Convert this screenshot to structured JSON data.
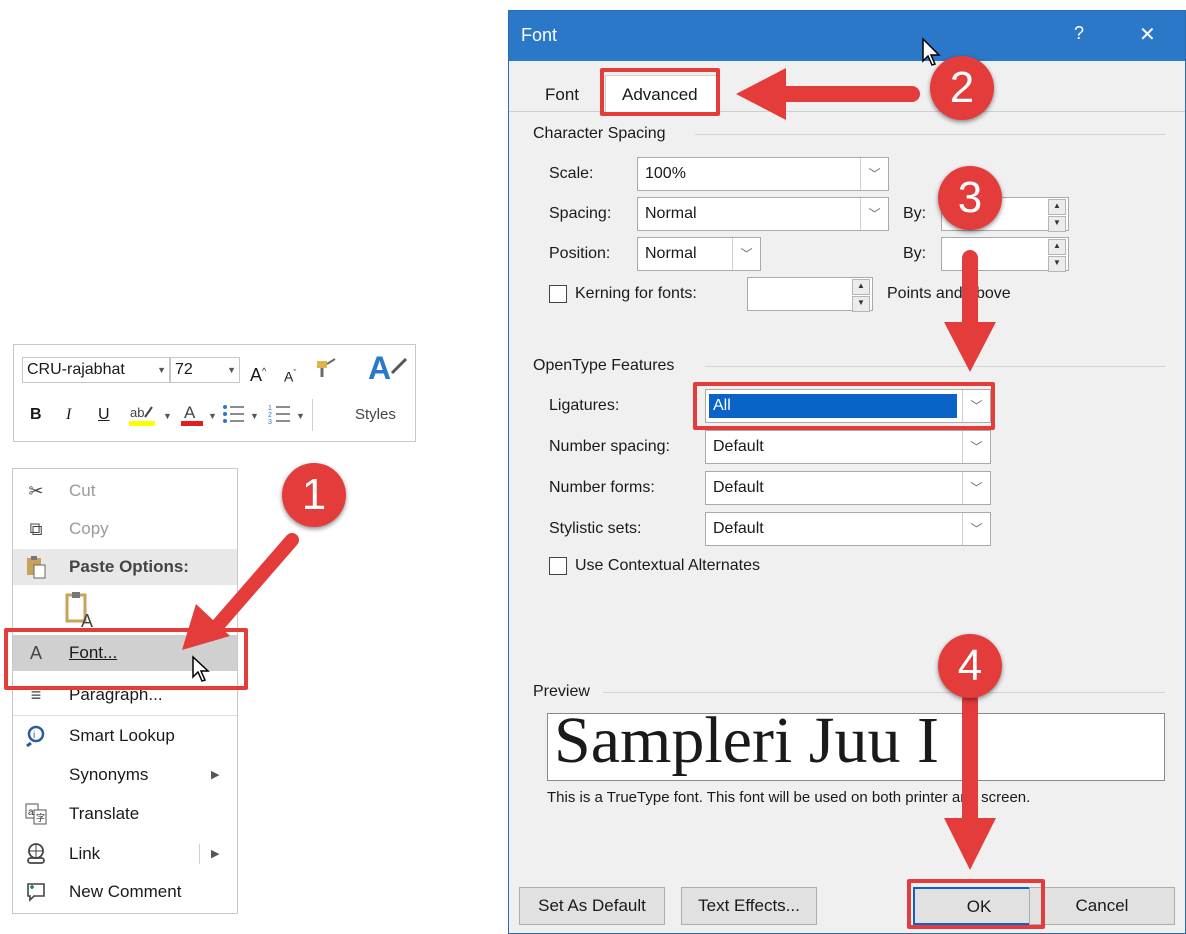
{
  "minibar": {
    "font_name": "CRU-rajabhat",
    "font_size": "72",
    "styles_label": "Styles",
    "grow_label": "A",
    "shrink_label": "A",
    "bold_label": "B",
    "italic_label": "I",
    "underline_label": "U",
    "font_color_label": "A"
  },
  "context_menu": {
    "cut": "Cut",
    "copy": "Copy",
    "paste_options": "Paste Options:",
    "font": "Font...",
    "paragraph": "Paragraph...",
    "smart_lookup": "Smart Lookup",
    "synonyms": "Synonyms",
    "translate": "Translate",
    "link": "Link",
    "new_comment": "New Comment",
    "font_icon_glyph": "A"
  },
  "dialog": {
    "title": "Font",
    "help": "?",
    "close": "✕",
    "tabs": {
      "font": "Font",
      "advanced": "Advanced"
    },
    "character_spacing": {
      "group": "Character Spacing",
      "scale_label": "Scale:",
      "scale_value": "100%",
      "spacing_label": "Spacing:",
      "spacing_value": "Normal",
      "position_label": "Position:",
      "position_value": "Normal",
      "by_label_1": "By:",
      "by_label_2": "By:",
      "kerning_label": "Kerning for fonts:",
      "points_label": "Points and above"
    },
    "opentype": {
      "group": "OpenType Features",
      "ligatures_label": "Ligatures:",
      "ligatures_value": "All",
      "number_spacing_label": "Number spacing:",
      "number_spacing_value": "Default",
      "number_forms_label": "Number forms:",
      "number_forms_value": "Default",
      "stylistic_sets_label": "Stylistic sets:",
      "stylistic_sets_value": "Default",
      "contextual_label": "Use Contextual Alternates"
    },
    "preview": {
      "group": "Preview",
      "sample_text": "Sampleri Juu I",
      "description": "This is a TrueType font. This font will be used on both printer and screen."
    },
    "buttons": {
      "set_default": "Set As Default",
      "text_effects": "Text Effects...",
      "ok": "OK",
      "cancel": "Cancel"
    }
  },
  "callouts": [
    "1",
    "2",
    "3",
    "4"
  ],
  "colors": {
    "accent_red": "#e43b3b",
    "title_blue": "#2b77c8",
    "selection_blue": "#0a64c8"
  }
}
